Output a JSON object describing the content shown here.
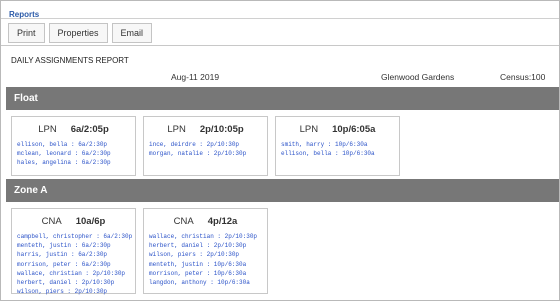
{
  "header": {
    "title": "Reports"
  },
  "toolbar": {
    "print": "Print",
    "properties": "Properties",
    "email": "Email"
  },
  "report": {
    "title": "DAILY ASSIGNMENTS REPORT",
    "date": "Aug-11 2019",
    "facility": "Glenwood Gardens",
    "census": "Census:100"
  },
  "sections": [
    {
      "name": "Float",
      "cards": [
        {
          "role": "LPN",
          "shift": "6a/2:05p",
          "assignments": [
            "ellison, bella : 6a/2:30p",
            "mclean, leonard : 6a/2:30p",
            "hales, angelina : 6a/2:30p"
          ]
        },
        {
          "role": "LPN",
          "shift": "2p/10:05p",
          "assignments": [
            "ince, deirdre : 2p/10:30p",
            "morgan, natalie : 2p/10:30p"
          ]
        },
        {
          "role": "LPN",
          "shift": "10p/6:05a",
          "assignments": [
            "smith, harry : 10p/6:30a",
            "ellison, bella : 10p/6:30a"
          ]
        }
      ]
    },
    {
      "name": "Zone A",
      "cards": [
        {
          "role": "CNA",
          "shift": "10a/6p",
          "assignments": [
            "campbell, christopher : 6a/2:30p",
            "menteth, justin : 6a/2:30p",
            "harris, justin : 6a/2:30p",
            "morrison, peter : 6a/2:30p",
            "wallace, christian : 2p/10:30p",
            "herbert, daniel : 2p/10:30p",
            "wilson, piers : 2p/10:30p"
          ]
        },
        {
          "role": "CNA",
          "shift": "4p/12a",
          "assignments": [
            "wallace, christian : 2p/10:30p",
            "herbert, daniel : 2p/10:30p",
            "wilson, piers : 2p/10:30p",
            "menteth, justin : 10p/6:30a",
            "morrison, peter : 10p/6:30a",
            "langdon, anthony : 10p/6:30a"
          ]
        }
      ]
    }
  ]
}
